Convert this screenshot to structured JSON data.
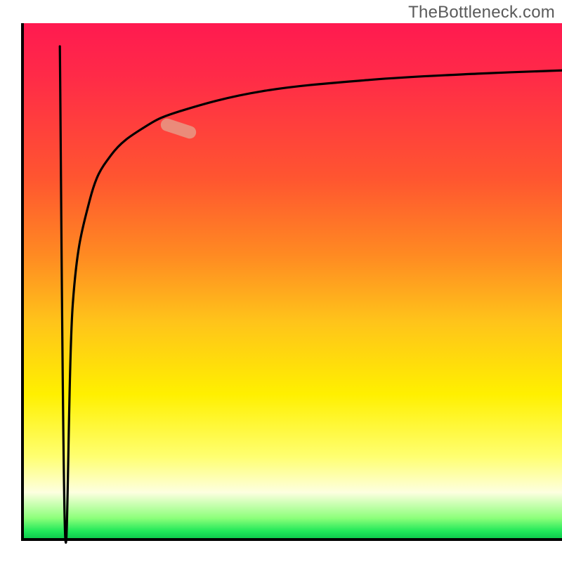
{
  "watermark": "TheBottleneck.com",
  "axes": {
    "x_range": [
      0,
      100
    ],
    "y_range": [
      0,
      100
    ]
  },
  "colors": {
    "curve": "#000000",
    "marker": "#e6a08c",
    "gradient_stops": [
      "#ff1a50",
      "#ff5530",
      "#ffc41a",
      "#fff000",
      "#ffff70",
      "#fdffe0",
      "#21e85a"
    ],
    "axis": "#000000",
    "watermark_text": "#5a5a5a"
  },
  "chart_data": {
    "type": "line",
    "title": "",
    "xlabel": "",
    "ylabel": "",
    "xlim": [
      0,
      100
    ],
    "ylim": [
      0,
      100
    ],
    "series": [
      {
        "name": "bottleneck-curve",
        "points": [
          {
            "x": 2.5,
            "y": 100
          },
          {
            "x": 3.5,
            "y": 5
          },
          {
            "x": 4.9,
            "y": 50
          },
          {
            "x": 8,
            "y": 70
          },
          {
            "x": 12,
            "y": 78.9
          },
          {
            "x": 18,
            "y": 84.2
          },
          {
            "x": 25,
            "y": 87.5
          },
          {
            "x": 40,
            "y": 91.3
          },
          {
            "x": 60,
            "y": 93.5
          },
          {
            "x": 80,
            "y": 94.7
          },
          {
            "x": 100,
            "y": 95.5
          }
        ]
      }
    ],
    "marker": {
      "x_center": 25,
      "y_center": 85,
      "rotation_deg": 18
    },
    "legend": false,
    "grid": false
  }
}
